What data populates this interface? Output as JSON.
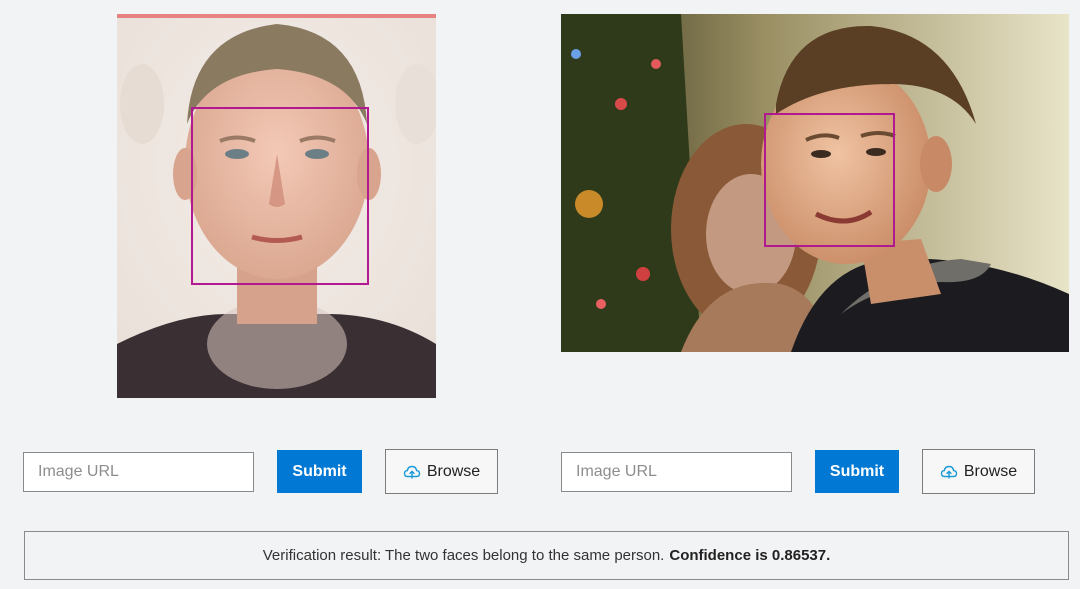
{
  "left_panel": {
    "url_placeholder": "Image URL",
    "submit_label": "Submit",
    "browse_label": "Browse",
    "browse_icon": "cloud-upload-icon"
  },
  "right_panel": {
    "url_placeholder": "Image URL",
    "submit_label": "Submit",
    "browse_label": "Browse",
    "browse_icon": "cloud-upload-icon"
  },
  "result": {
    "text": "Verification result: The two faces belong to the same person.",
    "confidence_text": "Confidence is 0.86537."
  },
  "colors": {
    "face_box": "#b0198f",
    "accent": "#0078d4",
    "icon": "#1a9bd7"
  }
}
